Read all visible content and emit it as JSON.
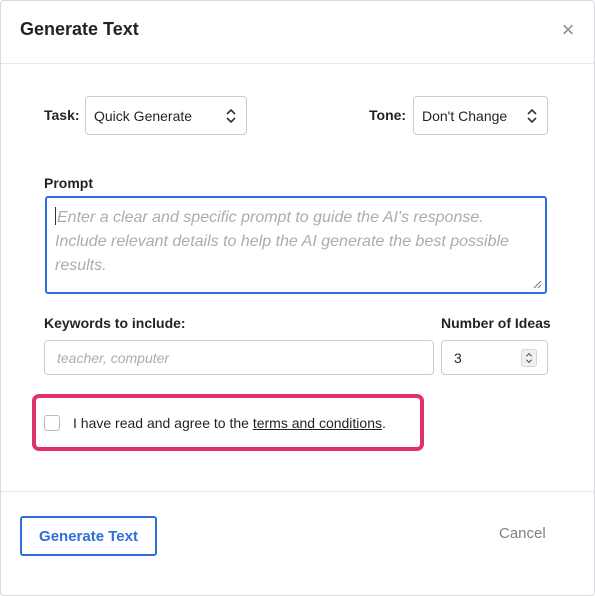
{
  "dialog": {
    "title": "Generate Text",
    "close_label": "×"
  },
  "task": {
    "label": "Task:",
    "selected": "Quick Generate"
  },
  "tone": {
    "label": "Tone:",
    "selected": "Don't Change"
  },
  "prompt": {
    "label": "Prompt",
    "placeholder": "Enter a clear and specific prompt to guide the AI's response. Include relevant details to help the AI generate the best possible results."
  },
  "keywords": {
    "label": "Keywords to include:",
    "placeholder": "teacher, computer"
  },
  "ideas": {
    "label": "Number of Ideas",
    "value": "3"
  },
  "agreement": {
    "text_before": "I have read and agree to the ",
    "link_text": "terms and conditions",
    "text_after": "."
  },
  "footer": {
    "generate_label": "Generate Text",
    "cancel_label": "Cancel"
  },
  "colors": {
    "primary": "#2f6fdc",
    "highlight": "#e0306f"
  },
  "icons": {
    "close": "close-icon",
    "select_chevron": "chevron-up-down-icon",
    "spinner": "spinner-arrows-icon",
    "resize": "resize-handle-icon"
  }
}
